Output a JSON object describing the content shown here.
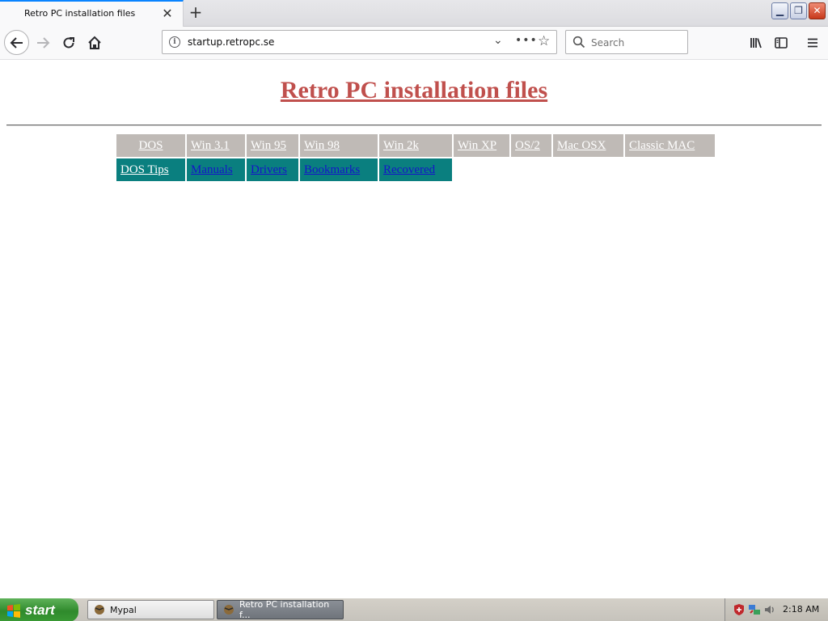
{
  "browser": {
    "tab_title": "Retro PC installation files",
    "url": "startup.retropc.se",
    "search_placeholder": "Search"
  },
  "page": {
    "title": "Retro PC installation files",
    "os_links": [
      "DOS",
      "Win 3.1",
      "Win 95",
      "Win 98",
      "Win 2k",
      "Win XP",
      "OS/2",
      "Mac OSX",
      "Classic MAC"
    ],
    "tool_links": [
      "DOS Tips",
      "Manuals",
      "Drivers",
      "Bookmarks",
      "Recovered"
    ]
  },
  "taskbar": {
    "start_label": "start",
    "tasks": [
      "Mypal",
      "Retro PC installation f..."
    ],
    "clock": "2:18 AM"
  },
  "colors": {
    "title": "#c0504d",
    "os_cell": "#bfbab6",
    "tool_cell": "#0a7f7f",
    "link": "#1515c8"
  }
}
